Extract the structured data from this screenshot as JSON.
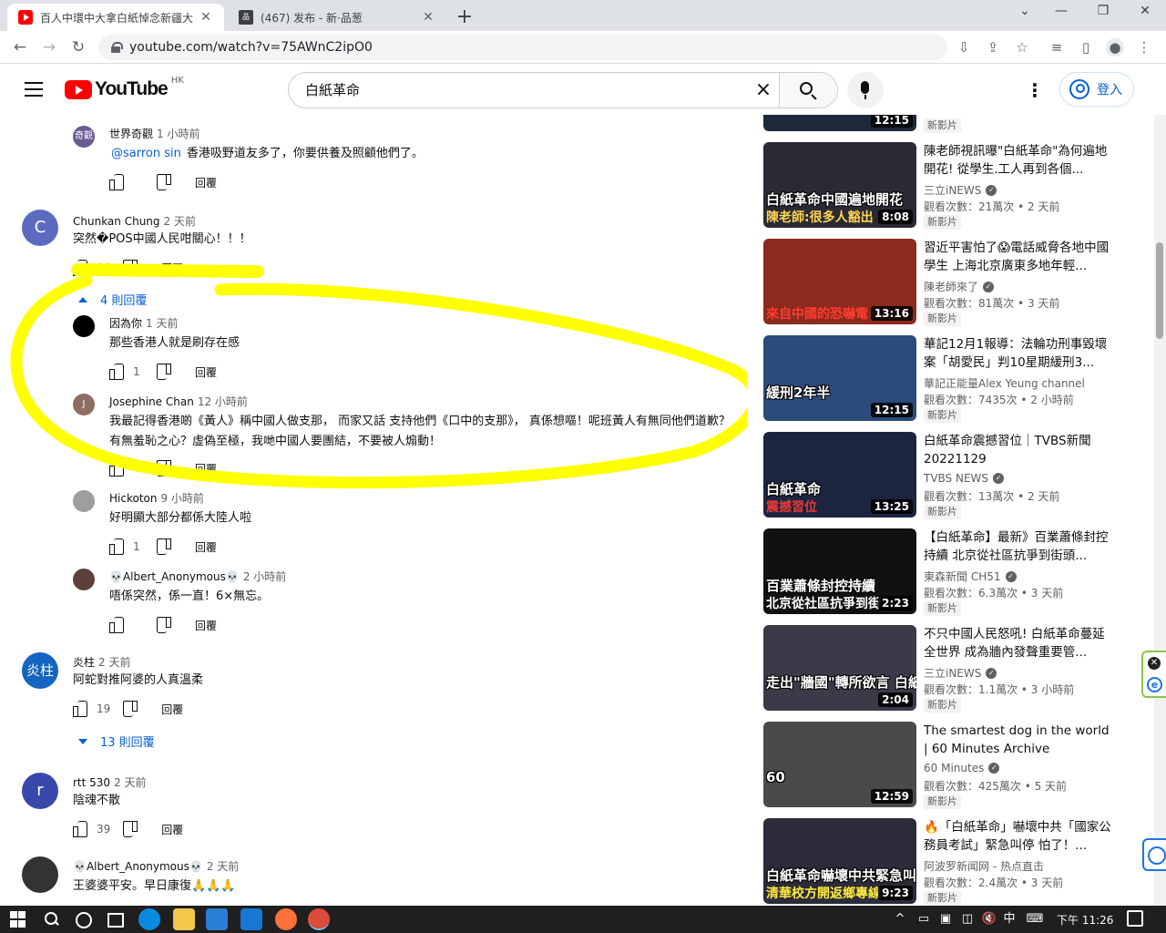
{
  "browser": {
    "tabs": [
      {
        "title": "百人中環中大拿白紙悼念新疆大火",
        "active": true
      },
      {
        "title": "(467) 发布 - 新·品葱",
        "active": false
      }
    ],
    "url": "youtube.com/watch?v=75AWnC2ipO0"
  },
  "youtube": {
    "logo_text": "YouTube",
    "region": "HK",
    "search_value": "白紙革命",
    "signin_label": "登入"
  },
  "comments": [
    {
      "avatar": "奇觀",
      "avatar_color": "#6b5b95",
      "author": "世界奇觀",
      "time": "1 小時前",
      "mention": "@sarron sin",
      "text": "香港吸野道友多了，你要供養及照顧他們了。",
      "likes": "",
      "reply": "回覆"
    },
    {
      "avatar": "C",
      "avatar_color": "#5c6bc0",
      "author": "Chunkan Chung",
      "time": "2 天前",
      "text": "突然�POS中國人民咁關心！！！",
      "likes": "18",
      "reply": "回覆"
    },
    {
      "avatar": "",
      "avatar_color": "#000000",
      "author": "因為你",
      "time": "1 天前",
      "text": "那些香港人就是刷存在感",
      "likes": "1",
      "reply": "回覆"
    },
    {
      "avatar": "J",
      "avatar_color": "#8d6e63",
      "author": "Josephine Chan",
      "time": "12 小時前",
      "text": "我最記得香港啲《黃人》稱中國人做支那， 而家又話 支持他們《口中的支那》， 真係想嘔！呢班黃人有無同他們道歉？有無羞恥之心？虛偽至極，我哋中國人要團結，不要被人煽動！",
      "likes": "",
      "reply": "回覆"
    },
    {
      "avatar": "",
      "avatar_color": "#9e9e9e",
      "author": "Hickoton",
      "time": "9 小時前",
      "text": "好明顯大部分都係大陸人啦",
      "likes": "1",
      "reply": "回覆"
    },
    {
      "avatar": "",
      "avatar_color": "#5d4037",
      "author": "💀Albert_Anonymous💀",
      "time": "2 小時前",
      "text": "唔係突然，係一直！6×無忘。",
      "likes": "",
      "reply": "回覆"
    },
    {
      "avatar": "炎柱",
      "avatar_color": "#1565c0",
      "author": "炎柱",
      "time": "2 天前",
      "text": "阿蛇對推阿婆的人真溫柔",
      "likes": "19",
      "reply": "回覆"
    },
    {
      "avatar": "r",
      "avatar_color": "#3949ab",
      "author": "rtt 530",
      "time": "2 天前",
      "text": "陰魂不散",
      "likes": "39",
      "reply": "回覆"
    },
    {
      "avatar": "",
      "avatar_color": "#333333",
      "author": "💀Albert_Anonymous💀",
      "time": "2 天前",
      "text": "王婆婆平安。早日康復🙏🙏🙏",
      "likes": "",
      "reply": "回覆"
    }
  ],
  "replies_toggles": [
    "4 則回覆",
    "13 則回覆"
  ],
  "sidebar": {
    "top_partial": {
      "duration": "12:15",
      "badge": "新影片"
    },
    "videos": [
      {
        "title": "陳老師視訊曝\"白紙革命\"為何遍地開花! 從學生.工人再到各個...",
        "channel": "三立iNEWS",
        "verified": true,
        "meta": "觀看次數：21萬次 • 2 天前",
        "badge": "新影片",
        "duration": "8:08",
        "cap1": "白紙革命中國遍地開花",
        "cap2": "陳老師:很多人豁出",
        "bg": "#2a2a35",
        "cap2_color": "#ffd54f"
      },
      {
        "title": "習近平害怕了😱電話威脅各地中國學生 上海北京廣東多地年輕...",
        "channel": "陳老師來了",
        "verified": true,
        "meta": "觀看次數：81萬次 • 3 天前",
        "badge": "新影片",
        "duration": "13:16",
        "cap1": "",
        "cap2": "來自中國的恐嚇電",
        "bg": "#8d2a1e",
        "cap2_color": "#ff3b30"
      },
      {
        "title": "華記12月1報導：法輪功刑事毀壞案「胡愛民」判10星期緩刑3...",
        "channel": "華記正能量Alex Yeung channel",
        "verified": false,
        "meta": "觀看次數：7435次 • 2 小時前",
        "badge": "新影片",
        "duration": "12:15",
        "cap1": "緩刑2年半",
        "cap2": "",
        "bg": "#2c4a7a",
        "cap2_color": "#ffffff"
      },
      {
        "title": "白紙革命震撼習位｜TVBS新聞 20221129",
        "channel": "TVBS NEWS",
        "verified": true,
        "meta": "觀看次數：13萬次 • 2 天前",
        "badge": "新影片",
        "duration": "13:25",
        "cap1": "白紙革命",
        "cap2": "震撼習位",
        "bg": "#1c2540",
        "cap2_color": "#e53935"
      },
      {
        "title": "【白紙革命】最新》百業蕭條封控持續 北京從社區抗爭到街頭...",
        "channel": "東森新聞 CH51",
        "verified": true,
        "meta": "觀看次數：6.3萬次 • 3 天前",
        "badge": "新影片",
        "duration": "2:23",
        "cap1": "百業蕭條封控持續",
        "cap2": "北京從社區抗爭到街",
        "bg": "#111111",
        "cap2_color": "#ffffff"
      },
      {
        "title": "不只中國人民怒吼! 白紙革命蔓延全世界 成為牆內發聲重要管...",
        "channel": "三立iNEWS",
        "verified": true,
        "meta": "觀看次數：1.1萬次 • 3 小時前",
        "badge": "新影片",
        "duration": "2:04",
        "cap1": "走出\"牆國\"轉所欲言 白紙革命",
        "cap2": "",
        "bg": "#3a3a48",
        "cap2_color": "#ffeb3b"
      },
      {
        "title": "The smartest dog in the world | 60 Minutes Archive",
        "channel": "60 Minutes",
        "verified": true,
        "meta": "觀看次數：425萬次 • 5 天前",
        "badge": "新影片",
        "duration": "12:59",
        "cap1": "60",
        "cap2": "",
        "bg": "#4a4a4a",
        "cap2_color": "#ffffff"
      },
      {
        "title": "🔥「白紙革命」嚇壞中共「國家公務員考試」緊急叫停 怕了！...",
        "channel": "阿波罗新闻网 - 热点直击",
        "verified": false,
        "meta": "觀看次數：2.4萬次 • 3 天前",
        "badge": "新影片",
        "duration": "9:23",
        "cap1": "白紙革命嚇壞中共緊急叫停",
        "cap2": "清華校方開返鄉專線",
        "bg": "#2b2b3a",
        "cap2_color": "#ffeb3b"
      }
    ]
  },
  "taskbar": {
    "ime": "中",
    "time": "下午 11:26"
  },
  "colors": {
    "yt_red": "#ff0000",
    "link_blue": "#065fd4",
    "annotation_yellow": "#ffff00"
  }
}
